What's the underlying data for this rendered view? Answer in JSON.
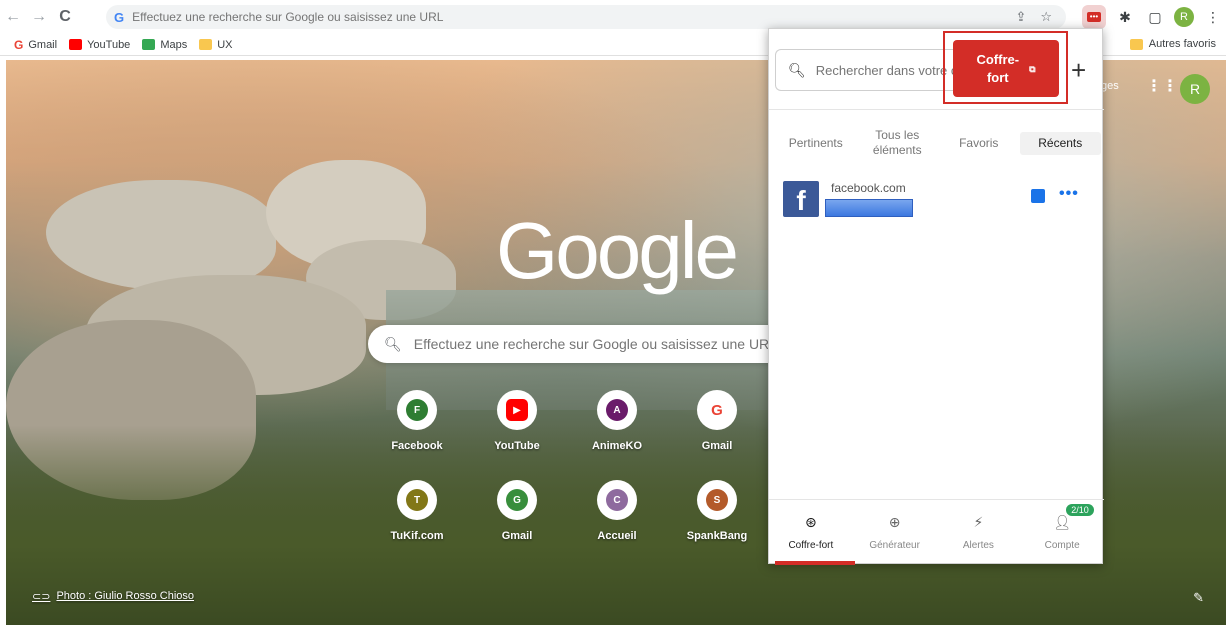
{
  "omnibox": {
    "placeholder": "Effectuez une recherche sur Google ou saisissez une URL"
  },
  "bookmarks": [
    {
      "label": "Gmail",
      "icon": "gmail-icon",
      "color": "#ea4335"
    },
    {
      "label": "YouTube",
      "icon": "youtube-icon",
      "color": "#ff0000"
    },
    {
      "label": "Maps",
      "icon": "maps-icon",
      "color": "#34a853"
    },
    {
      "label": "UX",
      "icon": "folder-icon",
      "color": "#f9c74f"
    }
  ],
  "bookmarks_other": "Autres favoris",
  "ntp": {
    "logo": "Google",
    "search_placeholder": "Effectuez une recherche sur Google ou saisissez une URL",
    "images_link": "ges",
    "avatar_letter": "R",
    "photo_credit": "Photo : Giulio Rosso Chioso",
    "shortcuts": [
      {
        "label": "Facebook",
        "letter": "F",
        "color": "#2e7d32"
      },
      {
        "label": "YouTube",
        "letter": "▶",
        "color": "#ff0000"
      },
      {
        "label": "AnimeKO",
        "letter": "A",
        "color": "#6a1b6a"
      },
      {
        "label": "Gmail",
        "letter": "G",
        "color": "#ea4335"
      },
      {
        "label": "TuKif.com",
        "letter": "T",
        "color": "#827717"
      },
      {
        "label": "Gmail",
        "letter": "G",
        "color": "#388e3c"
      },
      {
        "label": "Accueil",
        "letter": "C",
        "color": "#8e6a9e"
      },
      {
        "label": "SpankBang",
        "letter": "S",
        "color": "#b35a2a"
      }
    ]
  },
  "browser": {
    "avatar_letter": "R"
  },
  "popup": {
    "search_placeholder": "Rechercher dans votre coffre-fort",
    "vault_button_line1": "Coffre-",
    "vault_button_line2": "fort",
    "add_button": "+",
    "tabs": [
      {
        "label": "Pertinents",
        "active": false
      },
      {
        "label": "Tous les éléments",
        "active": false
      },
      {
        "label": "Favoris",
        "active": false
      },
      {
        "label": "Récents",
        "active": true
      }
    ],
    "items": [
      {
        "title": "facebook.com"
      }
    ],
    "nav": [
      {
        "label": "Coffre-fort",
        "icon": "vault-icon",
        "active": true
      },
      {
        "label": "Générateur",
        "icon": "generator-icon",
        "active": false
      },
      {
        "label": "Alertes",
        "icon": "alert-icon",
        "active": false
      },
      {
        "label": "Compte",
        "icon": "account-icon",
        "active": false,
        "badge": "2/10"
      }
    ],
    "accent_color": "#d32d27"
  }
}
